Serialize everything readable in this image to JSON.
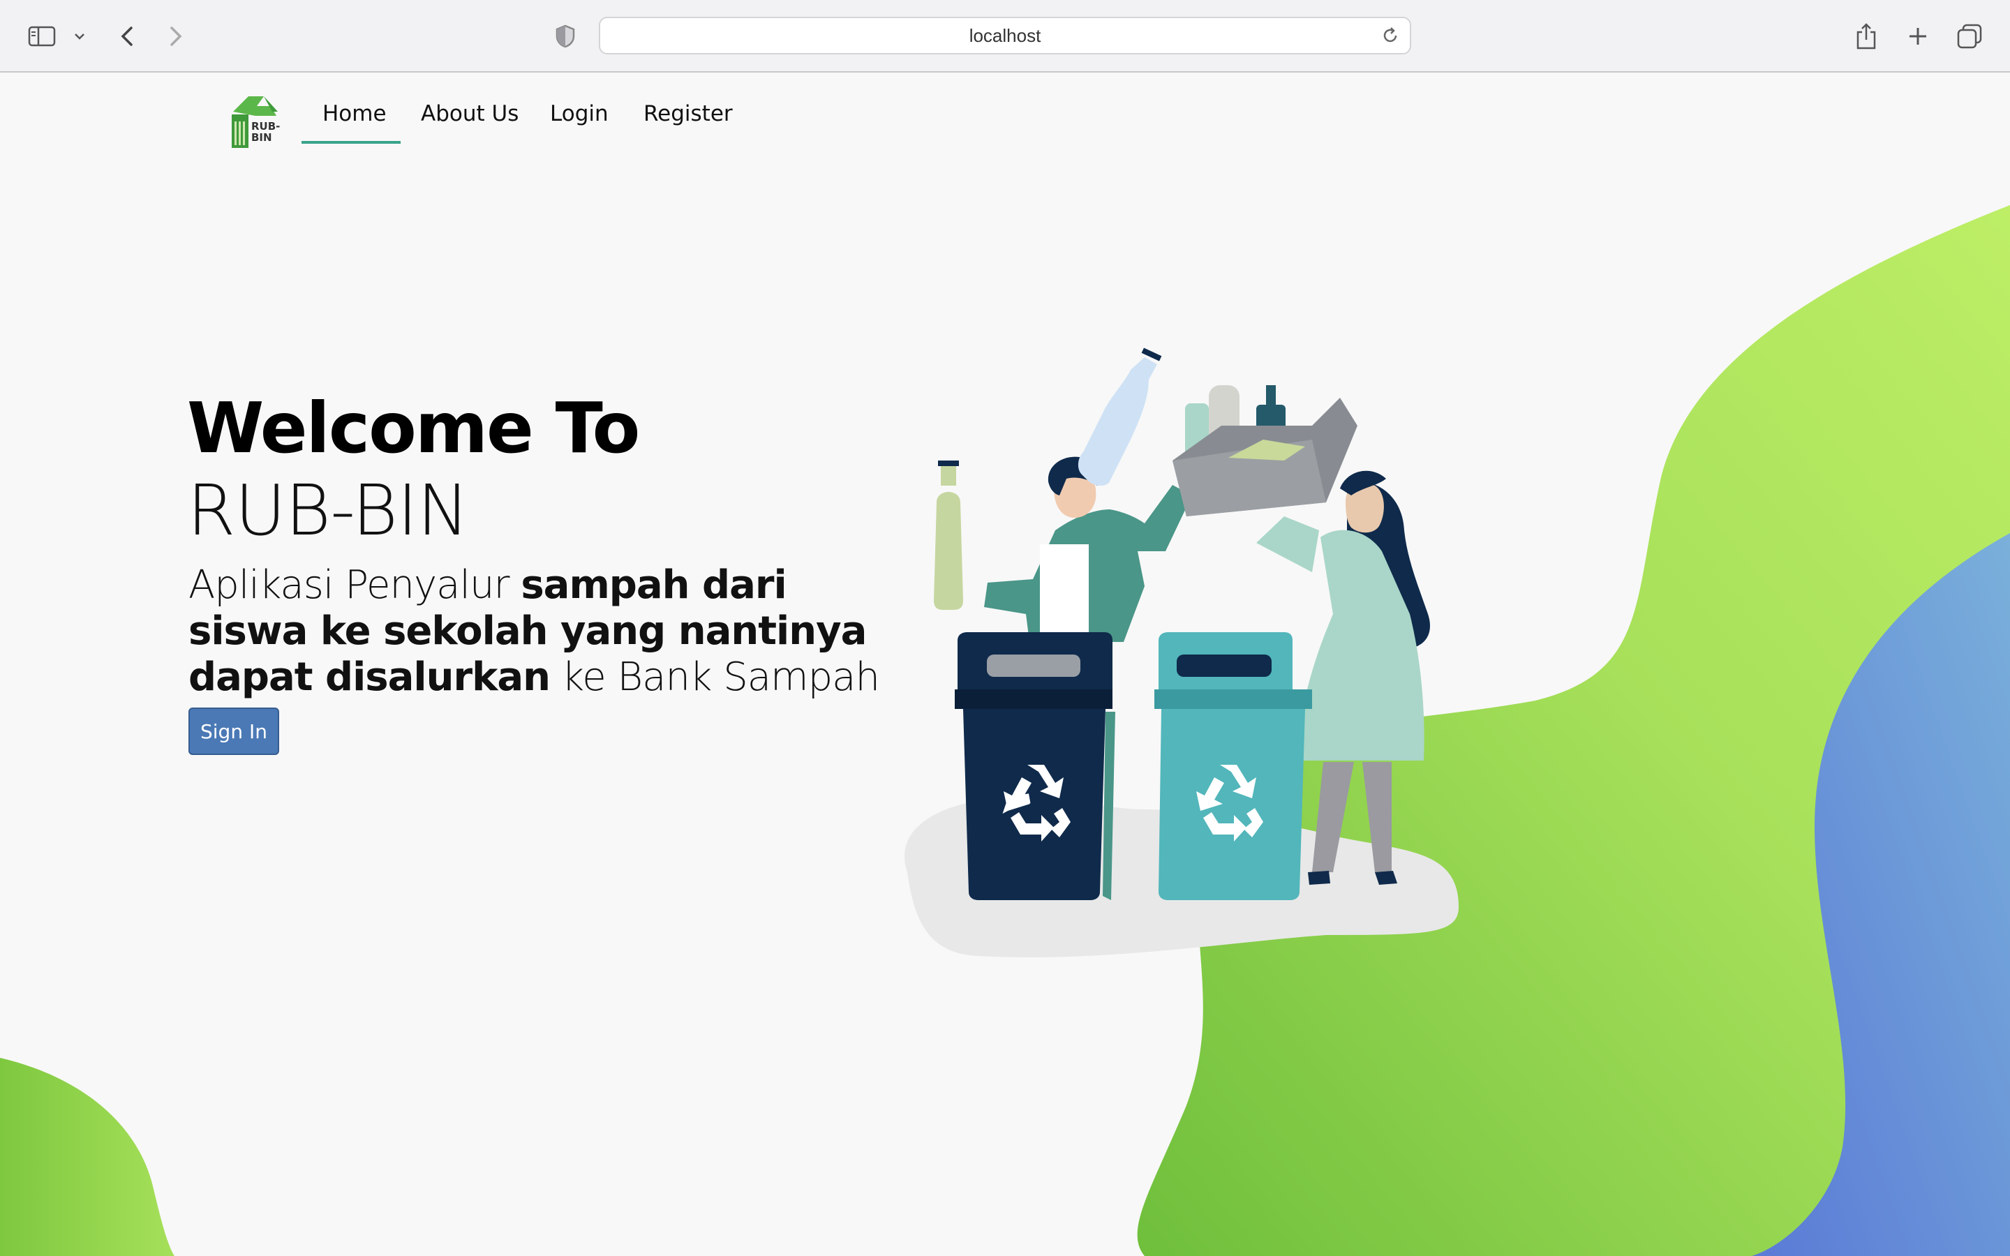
{
  "browser": {
    "url": "localhost",
    "icons": [
      "sidebar-icon",
      "chevron-down-icon",
      "back-icon",
      "forward-icon",
      "shield-icon",
      "reload-icon",
      "share-icon",
      "new-tab-icon",
      "tabs-overview-icon"
    ]
  },
  "nav": {
    "logo_text": "RUB-BIN",
    "items": [
      {
        "label": "Home",
        "active": true
      },
      {
        "label": "About Us"
      },
      {
        "label": "Login"
      },
      {
        "label": "Register"
      }
    ],
    "active_color": "#3aa38c"
  },
  "hero": {
    "welcome": "Welcome To",
    "brand": "RUB-BIN",
    "desc_light_1": "Aplikasi Penyalur ",
    "desc_bold": "sampah dari siswa ke sekolah yang nantinya dapat disalurkan",
    "desc_light_2": " ke Bank Sampah",
    "signin_label": "Sign In",
    "signin_color": "#4a79b5"
  },
  "colors": {
    "green_light": "#b6ea5f",
    "green_dark": "#7cc242",
    "blue": "#5a7fd8"
  }
}
